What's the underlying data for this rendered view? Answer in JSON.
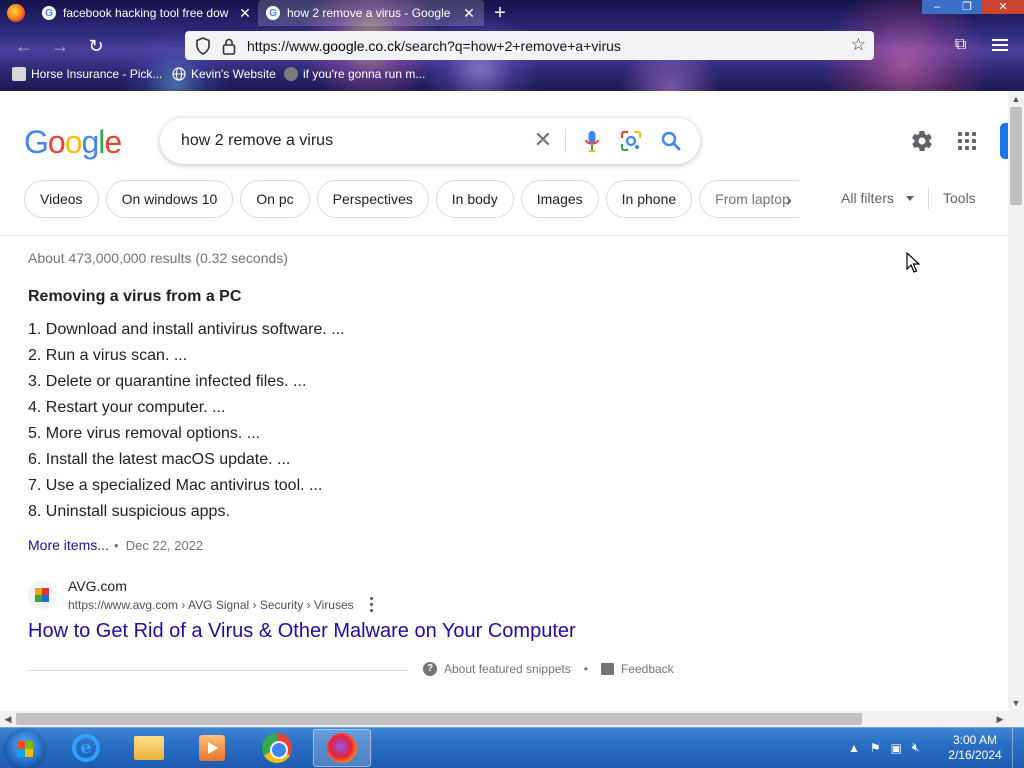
{
  "browser": {
    "tabs": [
      {
        "title": "facebook hacking tool free dow",
        "active": false
      },
      {
        "title": "how 2 remove a virus - Google",
        "active": true
      }
    ],
    "url_prefix": "https://www.",
    "url_domain": "google.co.ck",
    "url_path": "/search?q=how+2+remove+a+virus",
    "bookmarks": [
      {
        "label": "Horse Insurance - Pick..."
      },
      {
        "label": "Kevin's Website"
      },
      {
        "label": "if you're gonna run m..."
      }
    ]
  },
  "google": {
    "logo": {
      "l1": "G",
      "l2": "o",
      "l3": "o",
      "l4": "g",
      "l5": "l",
      "l6": "e"
    },
    "query": "how 2 remove a virus",
    "chips": [
      "Videos",
      "On windows 10",
      "On pc",
      "Perspectives",
      "In body",
      "Images",
      "In phone",
      "From laptop"
    ],
    "all_filters": "All filters",
    "tools": "Tools",
    "stats": "About 473,000,000 results (0.32 seconds)",
    "featured_snippet": {
      "title": "Removing a virus from a PC",
      "steps": [
        "1. Download and install antivirus software. ...",
        "2. Run a virus scan. ...",
        "3. Delete or quarantine infected files. ...",
        "4. Restart your computer. ...",
        "5. More virus removal options. ...",
        "6. Install the latest macOS update. ...",
        "7. Use a specialized Mac antivirus tool. ...",
        "8. Uninstall suspicious apps."
      ],
      "more_items": "More items...",
      "date_sep": "•",
      "date": "Dec 22, 2022"
    },
    "result": {
      "site_name": "AVG.com",
      "breadcrumb": "https://www.avg.com › AVG Signal › Security › Viruses",
      "title": "How to Get Rid of a Virus & Other Malware on Your Computer"
    },
    "about_snippets": "About featured snippets",
    "bullet": "•",
    "feedback": "Feedback"
  },
  "taskbar": {
    "time": "3:00 AM",
    "date": "2/16/2024",
    "apps": [
      "ie-icon",
      "explorer-icon",
      "media-player-icon",
      "chrome-icon",
      "firefox-icon"
    ]
  },
  "colors": {
    "link": "#1a0dab",
    "google_blue": "#4285f4",
    "google_red": "#ea4335",
    "google_yellow": "#fbbc05",
    "google_green": "#34a853",
    "taskbar": "#2a6fc4"
  }
}
